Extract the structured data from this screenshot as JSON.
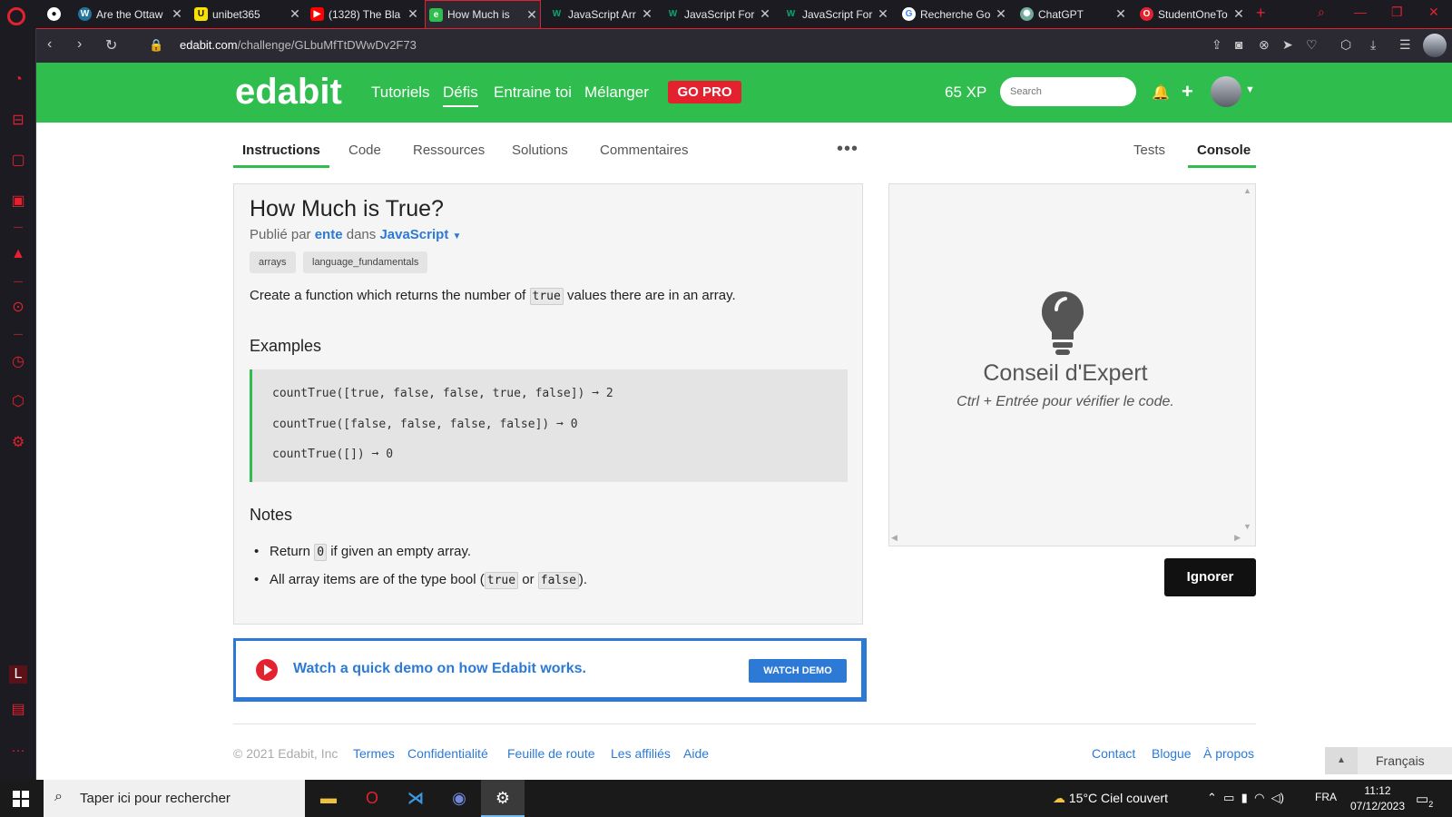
{
  "browser": {
    "tabs": [
      {
        "title": "Are the Ottaw",
        "icon": "wordpress-icon"
      },
      {
        "title": "unibet365",
        "icon": "unibet-icon"
      },
      {
        "title": "(1328) The Bla",
        "icon": "youtube-icon"
      },
      {
        "title": "How Much is",
        "icon": "edabit-icon",
        "active": true
      },
      {
        "title": "JavaScript Arr",
        "icon": "w3schools-icon"
      },
      {
        "title": "JavaScript For",
        "icon": "w3schools-icon"
      },
      {
        "title": "JavaScript For",
        "icon": "w3schools-icon"
      },
      {
        "title": "Recherche Go",
        "icon": "google-icon"
      },
      {
        "title": "ChatGPT",
        "icon": "chatgpt-icon"
      },
      {
        "title": "StudentOneTo",
        "icon": "opera-icon"
      }
    ],
    "url_host": "edabit.com",
    "url_path": "/challenge/GLbuMfTtDWwDv2F73"
  },
  "header": {
    "logo": "edabit",
    "nav": [
      "Tutoriels",
      "Défis",
      "Entraine toi",
      "Mélanger"
    ],
    "gopro": "GO PRO",
    "xp": "65 XP",
    "search_placeholder": "Search"
  },
  "page_tabs": {
    "left": [
      "Instructions",
      "Code",
      "Ressources",
      "Solutions",
      "Commentaires"
    ],
    "right": [
      "Tests",
      "Console"
    ],
    "more": "•••"
  },
  "challenge": {
    "title": "How Much is True?",
    "published_prefix": "Publié par",
    "author": "ente",
    "in_word": "dans",
    "language": "JavaScript",
    "tags": [
      "arrays",
      "language_fundamentals"
    ],
    "desc_before": "Create a function which returns the number of",
    "desc_code": "true",
    "desc_after": "values there are in an array.",
    "examples_heading": "Examples",
    "examples": [
      "countTrue([true, false, false, true, false]) ➞ 2",
      "countTrue([false, false, false, false]) ➞ 0",
      "countTrue([]) ➞ 0"
    ],
    "notes_heading": "Notes",
    "note1_before": "Return",
    "note1_code": "0",
    "note1_after": "if given an empty array.",
    "note2_before": "All array items are of the type bool (",
    "note2_code1": "true",
    "note2_mid": "or",
    "note2_code2": "false",
    "note2_after": ")."
  },
  "demo": {
    "text": "Watch a quick demo on how Edabit works.",
    "button": "WATCH DEMO"
  },
  "hint": {
    "title": "Conseil d'Expert",
    "subtitle": "Ctrl + Entrée pour vérifier le code.",
    "ignore": "Ignorer"
  },
  "footer": {
    "copyright": "© 2021 Edabit, Inc",
    "left_links": [
      "Termes",
      "Confidentialité",
      "Feuille de route",
      "Les affiliés",
      "Aide"
    ],
    "right_links": [
      "Contact",
      "Blogue",
      "À propos"
    ],
    "language": "Français"
  },
  "taskbar": {
    "search": "Taper ici pour rechercher",
    "weather": "15°C  Ciel couvert",
    "lang": "FRA",
    "time": "11:12",
    "date": "07/12/2023",
    "notifications": "2"
  },
  "colors": {
    "brand_green": "#2fbd4e",
    "link_blue": "#2c7ad6",
    "opera_red": "#e3212f"
  }
}
